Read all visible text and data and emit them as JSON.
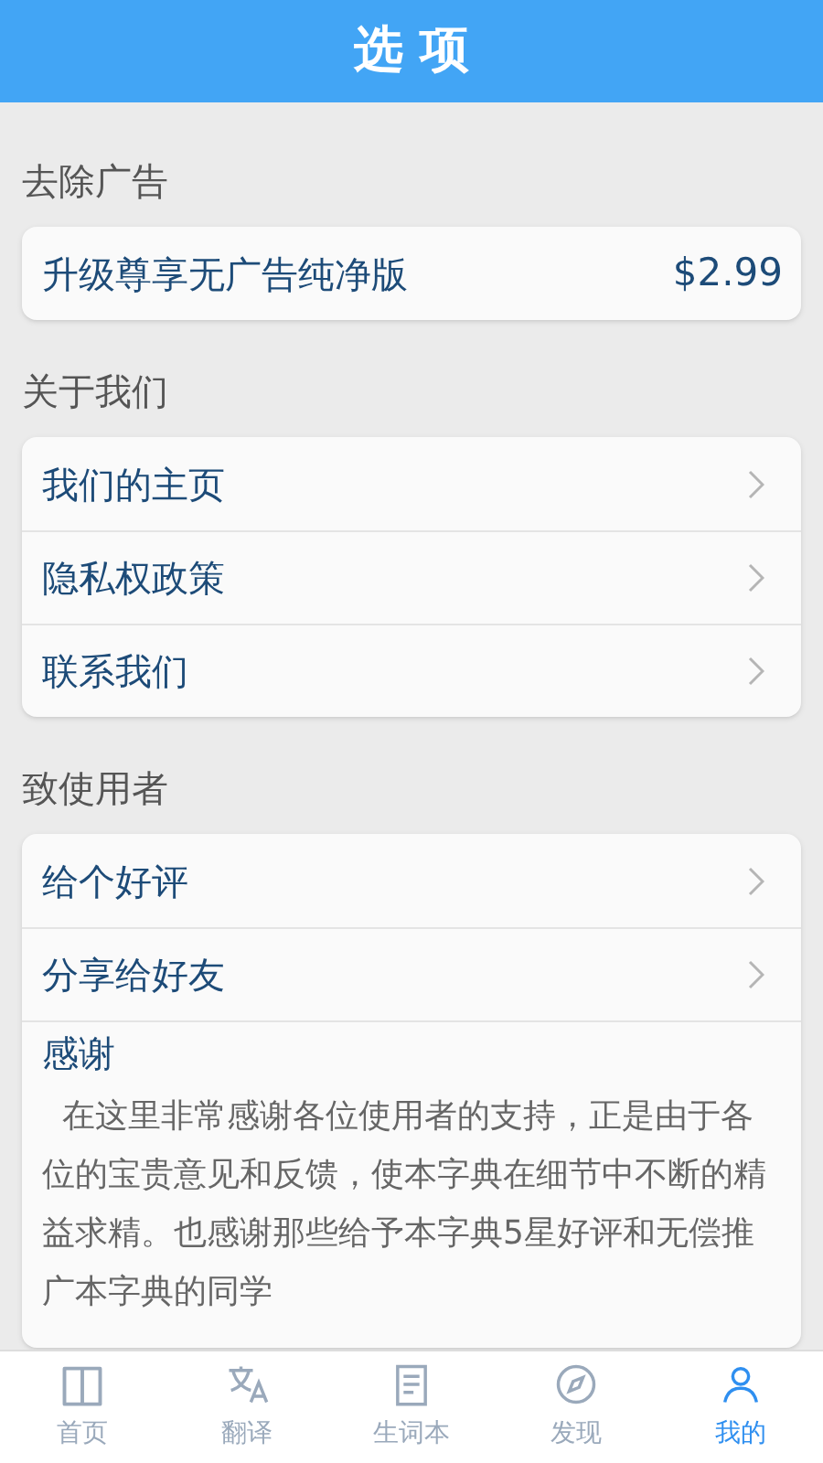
{
  "header": {
    "title": "选 项"
  },
  "sections": [
    {
      "label": "去除广告",
      "rows": [
        {
          "kind": "price",
          "label": "升级尊享无广告纯净版",
          "value": "$2.99"
        }
      ]
    },
    {
      "label": "关于我们",
      "rows": [
        {
          "kind": "link",
          "label": "我们的主页"
        },
        {
          "kind": "link",
          "label": "隐私权政策"
        },
        {
          "kind": "link",
          "label": "联系我们"
        }
      ]
    },
    {
      "label": "致使用者",
      "rows": [
        {
          "kind": "link",
          "label": "给个好评"
        },
        {
          "kind": "link",
          "label": "分享给好友"
        },
        {
          "kind": "note",
          "label": "感谢",
          "text": "在这里非常感谢各位使用者的支持，正是由于各位的宝贵意见和反馈，使本字典在细节中不断的精益求精。也感谢那些给予本字典5星好评和无偿推广本字典的同学"
        }
      ]
    }
  ],
  "tabs": [
    {
      "kind": "book",
      "label": "首页",
      "selected": false
    },
    {
      "kind": "translate",
      "label": "翻译",
      "selected": false
    },
    {
      "kind": "list",
      "label": "生词本",
      "selected": false
    },
    {
      "kind": "compass",
      "label": "发现",
      "selected": false
    },
    {
      "kind": "person",
      "label": "我的",
      "selected": true
    }
  ]
}
